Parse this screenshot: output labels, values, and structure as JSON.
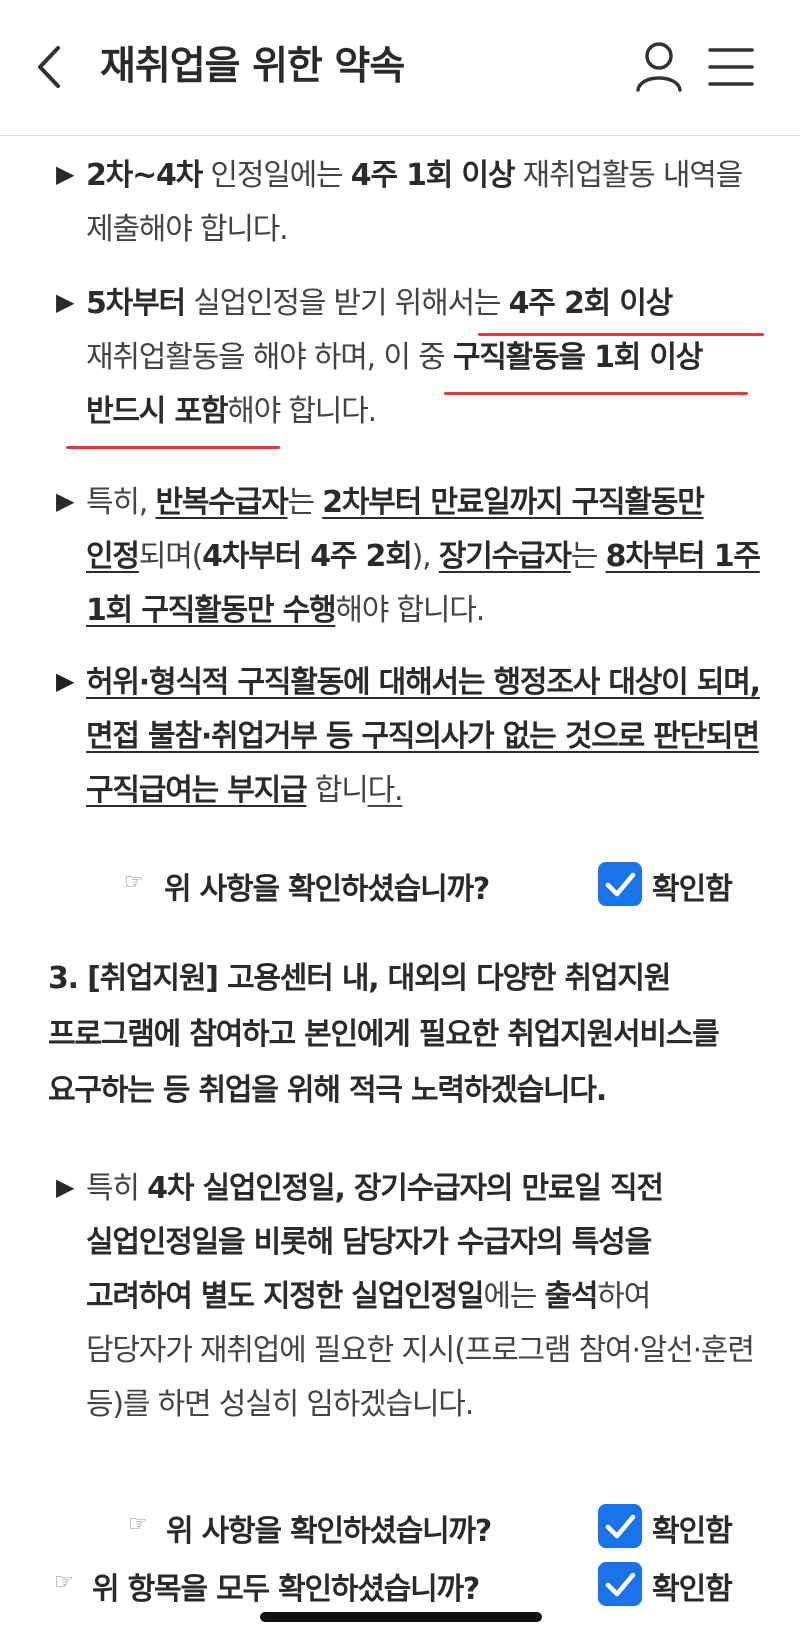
{
  "header": {
    "title": "재취업을 위한 약속",
    "back_icon": "chevron-left-icon",
    "user_icon": "user-icon",
    "menu_icon": "hamburger-menu-icon"
  },
  "bullet_glyph": "▶",
  "hand_glyph": "☞",
  "items": {
    "p1": {
      "s1": "2차~4차",
      "s2": " 인정일에는 ",
      "s3": "4주 1회 이상",
      "s4": " 재취업활동 내역을 제출해야 합니다."
    },
    "p2": {
      "s1": "5차부터",
      "s2": " 실업인정을 받기 위해서는 ",
      "s3": "4주 2회 이상",
      "s4": " 재취업활동을 해야 하며, 이 중 ",
      "s5": "구직활동을 1회 이상 반드시 포함",
      "s6": "해야 합니다."
    },
    "p3": {
      "s1": "특히, ",
      "s2": "반복수급자",
      "s3": "는 ",
      "s4": "2차부터 만료일까지 구직활동만 인정",
      "s5": "되며(",
      "s6": "4차부터 4주 2회",
      "s7": "), ",
      "s8": "장기수급자",
      "s9": "는 ",
      "s10": "8차부터 1주 1회 구직활동만 수행",
      "s11": "해야 합니다."
    },
    "p4": {
      "s1": "허위·형식적 구직활동에 대해서는 행정조사 대상이 되며, 면접 불참·취업거부 등 구직의사가 없는 것으로 판단되면 구직급여는 부지급",
      "s2": " 합니",
      "s3": "다."
    },
    "p5": {
      "s1": "특히 ",
      "s2": "4차 실업인정일, 장기수급자의 만료일 직전 실업인정일을 비롯해 담당자가 수급자의 특성을 고려하여 별도 지정한 실업인정일",
      "s3": "에는 ",
      "s4": "출석",
      "s5": "하여 담당자가 재취업에 필요한 지시(프로그램 참여·알선·훈련 등)를 하면 성실히 임하겠습니다."
    }
  },
  "confirm1": {
    "question": "위 사항을 확인하셨습니까?",
    "label": "확인함",
    "checked": true
  },
  "section3": {
    "heading": "3. [취업지원] 고용센터 내, 대외의 다양한 취업지원 프로그램에 참여하고 본인에게 필요한 취업지원서비스를 요구하는 등 취업을 위해 적극 노력하겠습니다."
  },
  "confirm2": {
    "question": "위 사항을 확인하셨습니까?",
    "label": "확인함",
    "checked": true
  },
  "confirm_all": {
    "question": "위 항목을 모두 확인하셨습니까?",
    "label": "확인함",
    "checked": true
  },
  "colors": {
    "accent": "#1a73e8",
    "highlight": "#e23a3a"
  }
}
